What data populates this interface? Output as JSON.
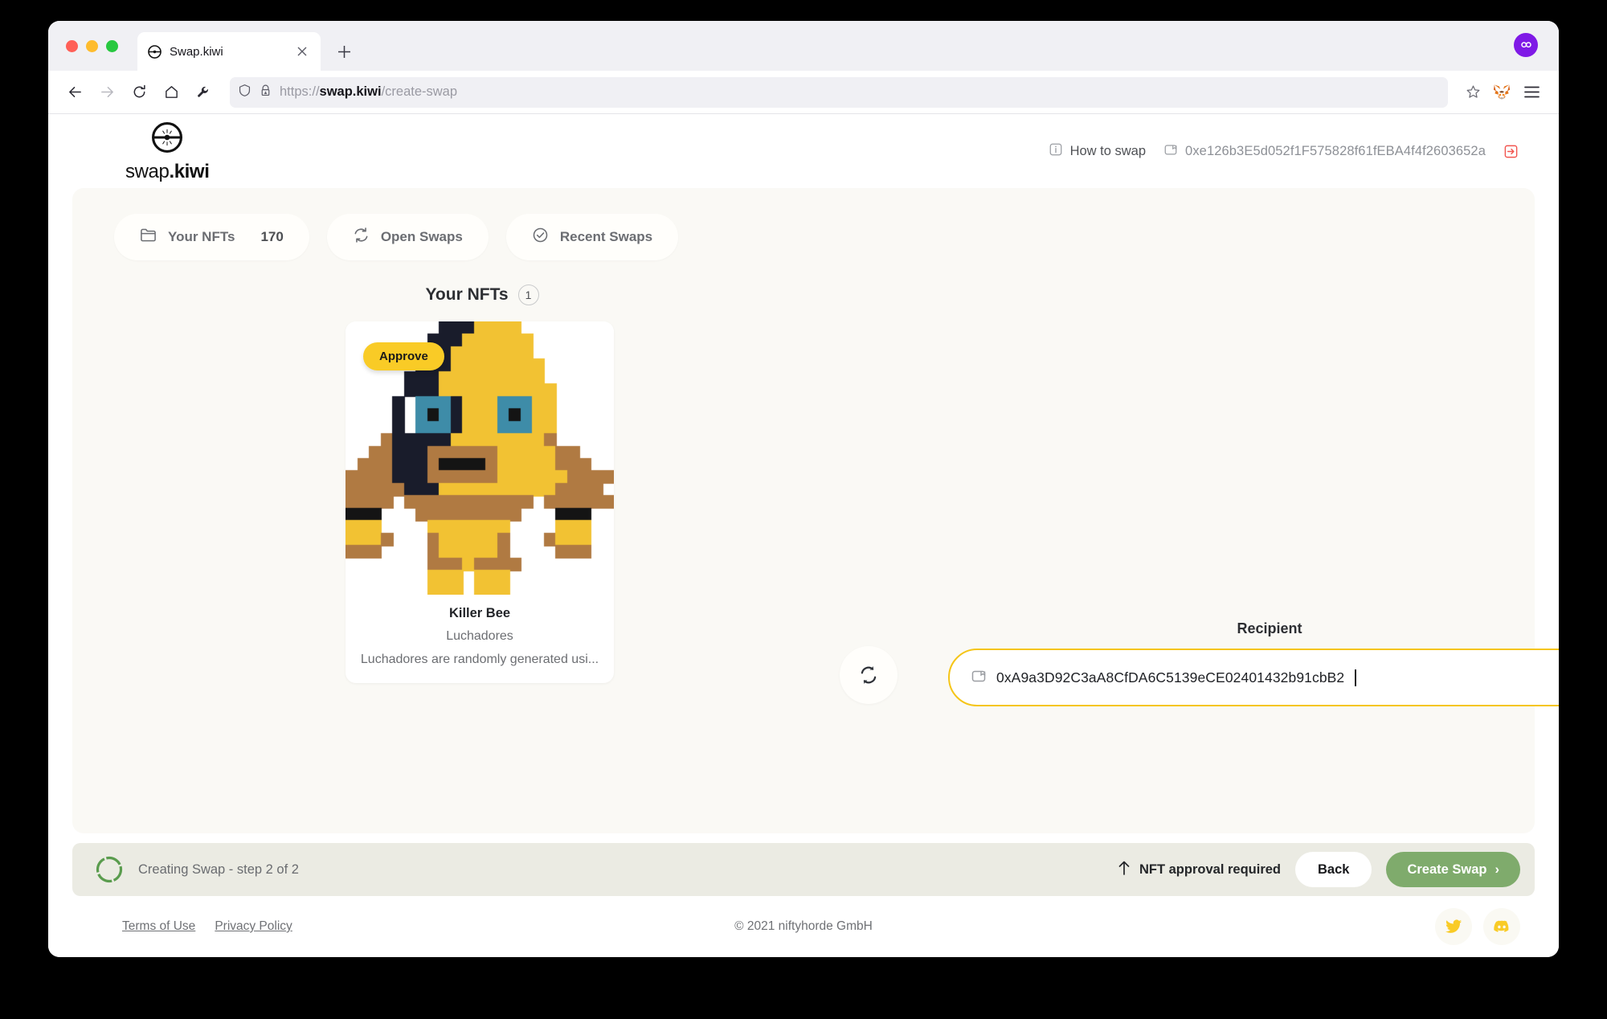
{
  "browser": {
    "tab": {
      "title": "Swap.kiwi",
      "favicon_icon": "swap-kiwi-favicon",
      "close_icon": "close-icon"
    },
    "new_tab_icon": "plus-icon",
    "profile_icon": "profile-avatar-icon",
    "nav": {
      "back_icon": "back-arrow-icon",
      "forward_icon": "forward-arrow-icon",
      "reload_icon": "reload-icon",
      "home_icon": "home-icon",
      "tools_icon": "wrench-icon",
      "shield_icon": "shield-icon",
      "lock_warning_icon": "lock-warning-icon",
      "bookmark_icon": "star-icon",
      "extension_icon": "metamask-fox-icon",
      "menu_icon": "hamburger-menu-icon"
    },
    "url": {
      "scheme": "https://",
      "host": "swap.kiwi",
      "path": "/create-swap"
    }
  },
  "header": {
    "logo_text_light": "swap",
    "logo_text_bold": ".kiwi",
    "logo_icon": "swap-kiwi-logo-icon",
    "how_to_swap": "How to swap",
    "info_icon": "info-icon",
    "wallet_icon": "wallet-icon",
    "wallet_address": "0xe126b3E5d052f1F575828f61fEBA4f4f2603652a",
    "logout_icon": "logout-icon"
  },
  "tabs": [
    {
      "label": "Your NFTs",
      "count": "170",
      "icon": "folder-icon"
    },
    {
      "label": "Open Swaps",
      "count": "",
      "icon": "refresh-icon"
    },
    {
      "label": "Recent Swaps",
      "count": "",
      "icon": "check-circle-icon"
    }
  ],
  "nft_section": {
    "title": "Your NFTs",
    "count": "1",
    "card": {
      "approve_label": "Approve",
      "name": "Killer Bee",
      "collection": "Luchadores",
      "description": "Luchadores are randomly generated usi..."
    }
  },
  "swap_toggle_icon": "swap-arrows-icon",
  "recipient": {
    "label": "Recipient",
    "wallet_icon": "wallet-icon",
    "value": "0xA9a3D92C3aA8CfDA6C5139eCE02401432b91cbB2"
  },
  "action_bar": {
    "progress_icon": "progress-ring-icon",
    "step_text": "Creating Swap - step 2 of 2",
    "approval_icon": "up-arrow-icon",
    "approval_note": "NFT approval required",
    "back_label": "Back",
    "create_label": "Create Swap",
    "create_chevron": "›"
  },
  "footer": {
    "terms": "Terms of Use",
    "privacy": "Privacy Policy",
    "copyright": "© 2021 niftyhorde GmbH",
    "twitter_icon": "twitter-icon",
    "discord_icon": "discord-icon"
  },
  "colors": {
    "accent_yellow": "#f5c518",
    "approve_yellow": "#f9cb26",
    "create_green": "#7fab6c",
    "logout_red": "#f2554f",
    "panel_bg": "#faf9f5",
    "action_bar_bg": "#ebebe3",
    "profile_purple": "#7f19e6"
  },
  "nft_pixel_art": {
    "palette": {
      "w": "#ffffff",
      "d": "#191c2b",
      "y": "#f2c233",
      "b": "#3e8ca8",
      "l": "#93c6d6",
      "t": "#b07a42",
      "k": "#141414"
    },
    "grid": [
      "wwwwwwwwdddyyyywwwwwwww",
      "wwwwwwwdddyyyyyywwwwwww",
      "wwwwwwdddyyyyyyywwwwwww",
      "wwwwwwdddyyyyyyyywwwwww",
      "wwwwwdddyyyyyyyyywwwwww",
      "wwwwwdddyyyyyyyyyywwwww",
      "wwwwdwbbbdyyybbbyywwwww",
      "wwwwdwbkbdyyybkbyywwwww",
      "wwwwdwbbbdyyybbbyywwwww",
      "wwwtdddddyyyyyyyytwwwww",
      "wwttdddttttttyyyyyttwww",
      "wtttdddtkkkktyyyyytttww",
      "ttttdddttttttyyyyyytttt",
      "tttttdddyyyyyyyyyytttt t",
      "ttttwtttttttttttwtttttt",
      "kkkwwwtttttttttwwwkkkww",
      "yyywwwwyyyyyyywwwwyyyww",
      "yyytwwwtyyyyytwwwtyyyww",
      "tttwwwwtyyyyytwwwwtttww",
      "wwwwwwwtttyttttwwwwwwww",
      "wwwwwwwyyywyyywwwwwwwww",
      "wwwwwwwyyywyyywwwwwwwww"
    ]
  }
}
